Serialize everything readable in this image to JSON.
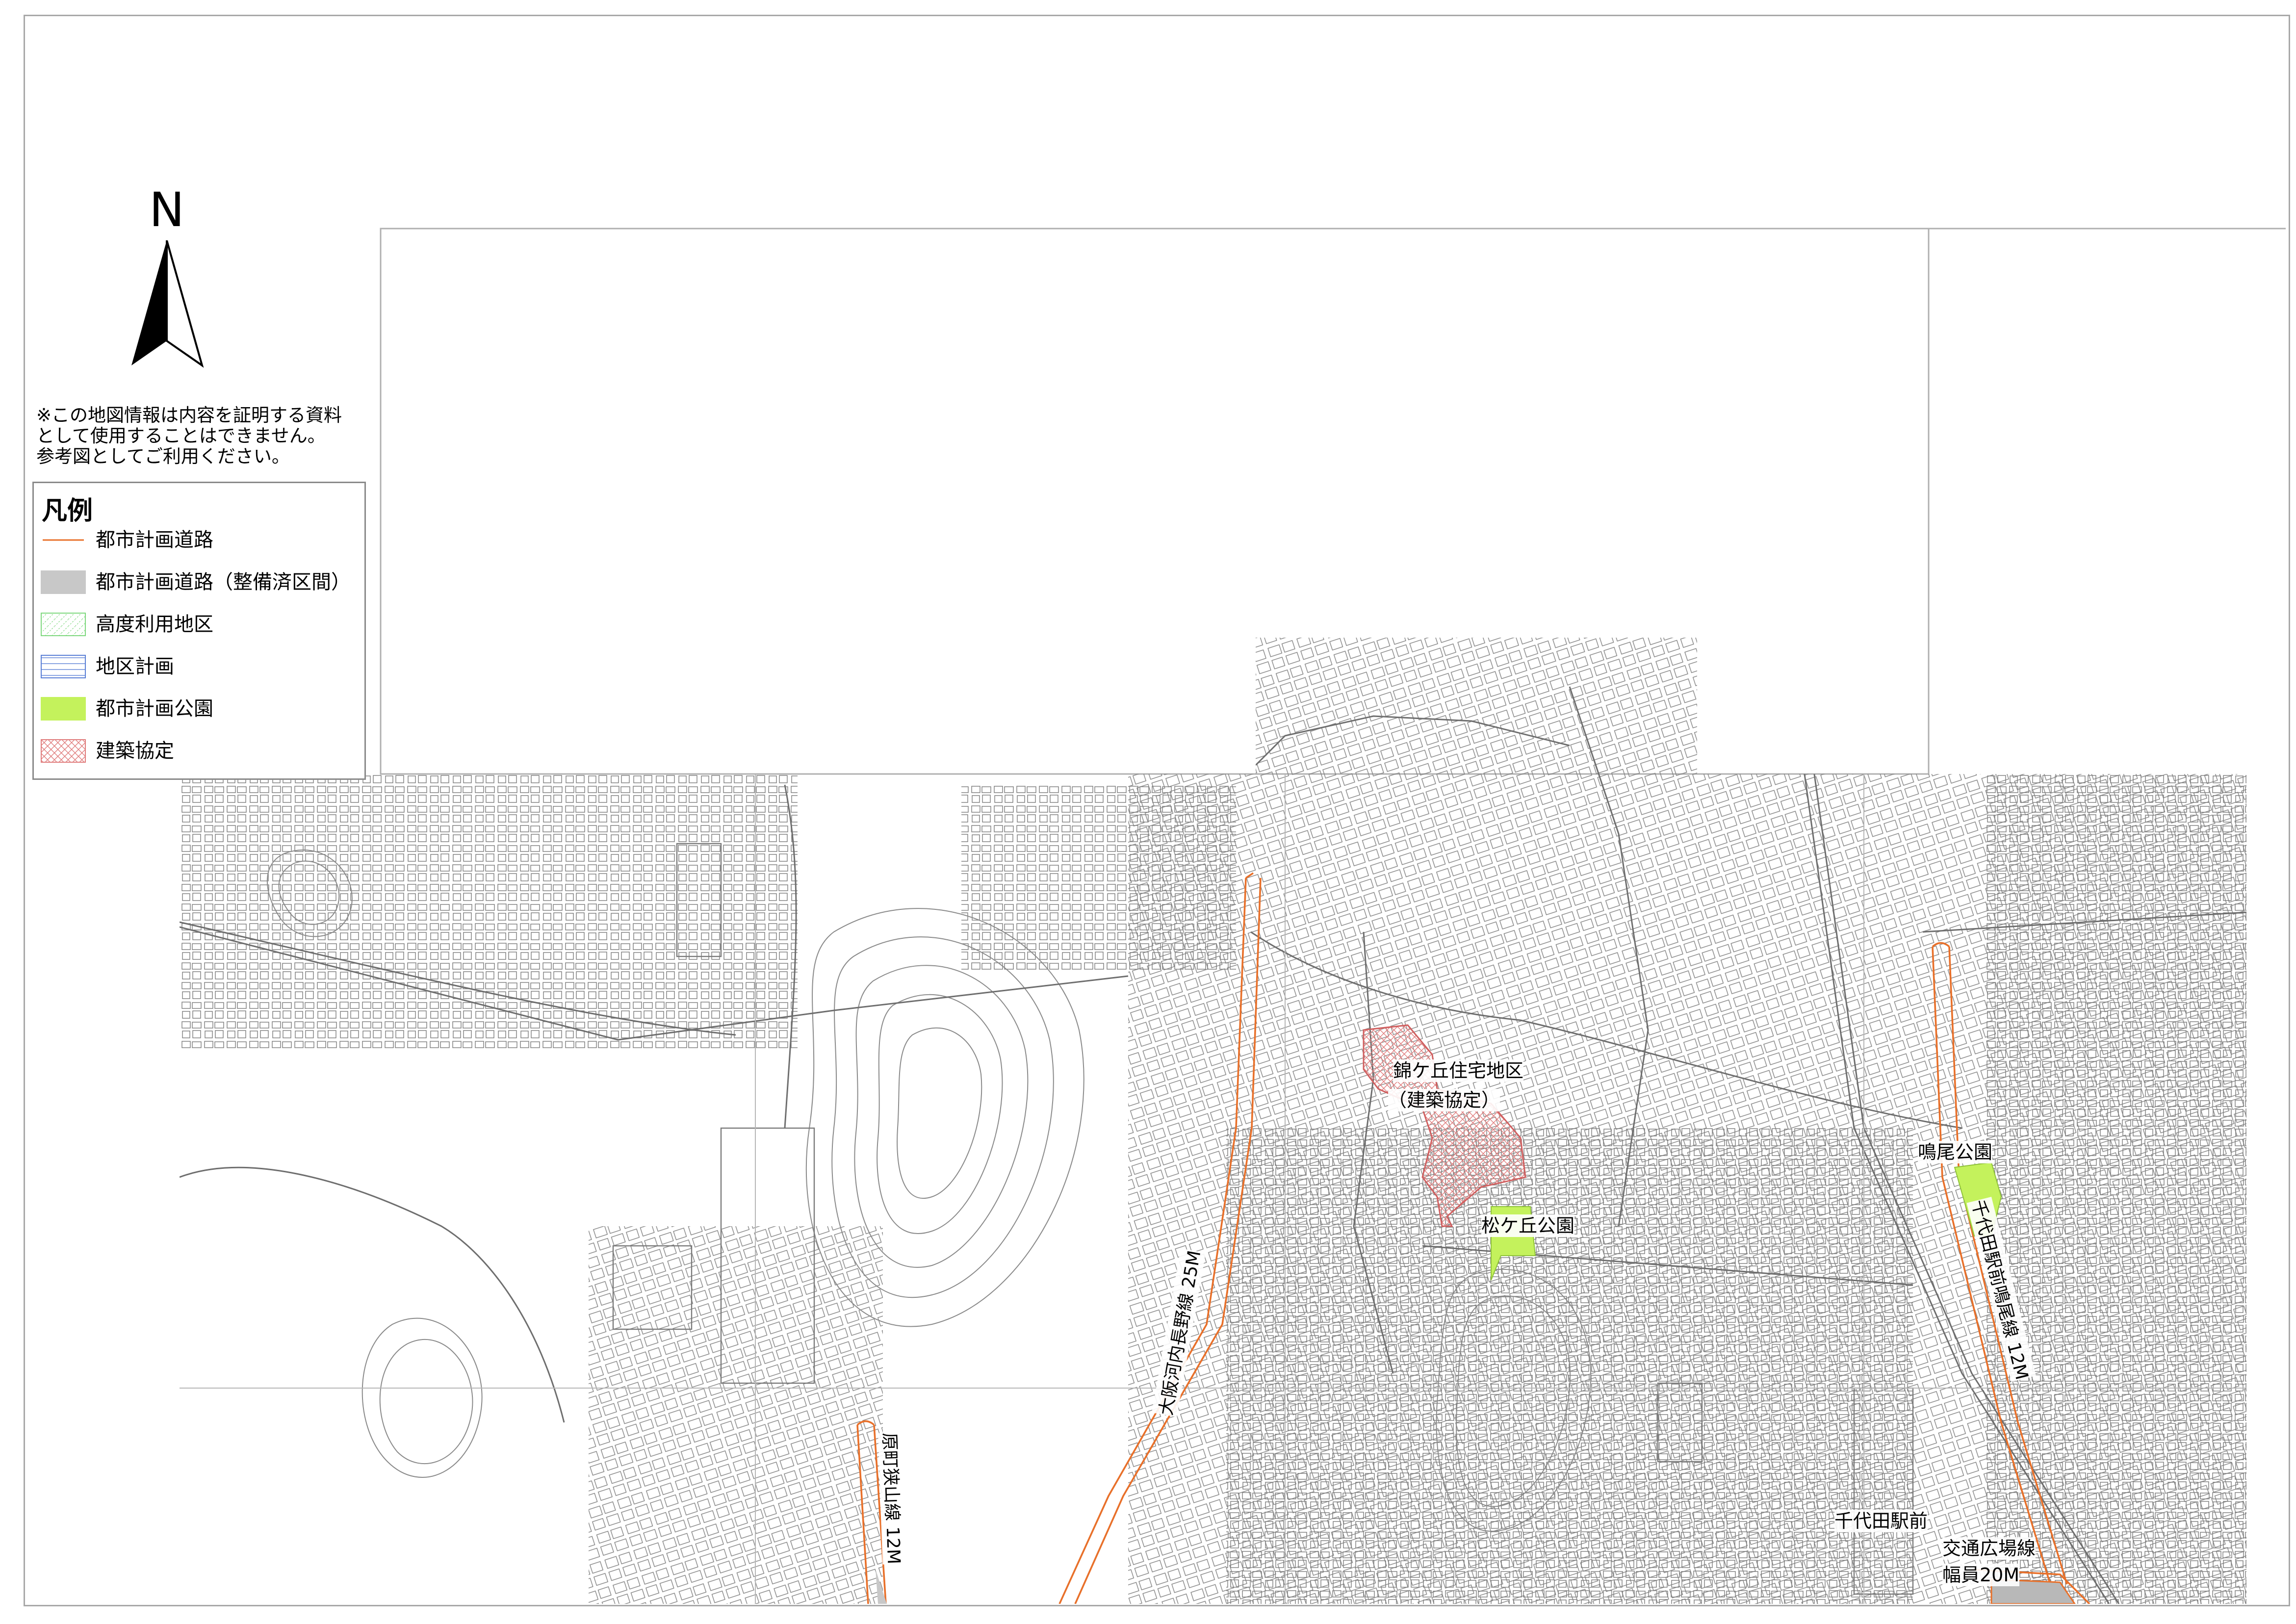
{
  "north_arrow": {
    "letter": "N"
  },
  "disclaimer": {
    "lines": [
      "※この地図情報は内容を証明する資料",
      "として使用することはできません。",
      "参考図としてご利用ください。"
    ]
  },
  "legend": {
    "title": "凡例",
    "items": [
      {
        "label": "都市計画道路",
        "style": "line",
        "color": "#e8702a"
      },
      {
        "label": "都市計画道路（整備済区間）",
        "style": "fill",
        "color": "#c8c8c8"
      },
      {
        "label": "高度利用地区",
        "style": "hatch-dots",
        "color": "#7ed87e"
      },
      {
        "label": "地区計画",
        "style": "hatch-lines",
        "color": "#5a7fd6"
      },
      {
        "label": "都市計画公園",
        "style": "fill",
        "color": "#c4f25c"
      },
      {
        "label": "建築協定",
        "style": "hatch-cross",
        "color": "#e07c7c"
      }
    ]
  },
  "map_labels": {
    "nishikigaoka_1": "錦ケ丘住宅地区",
    "nishikigaoka_2": "（建築協定）",
    "matsugaoka_park": "松ケ丘公園",
    "naruo_park": "鳴尾公園",
    "chiyoda_station_1": "千代田駅前",
    "chiyoda_station_2": "交通広場線",
    "chiyoda_station_3": "幅員20M",
    "road_osaka": "大阪河内長野線 25M",
    "road_haramachi": "原町狭山線 12M",
    "road_chiyoda": "千代田駅前鳴尾線 12M"
  },
  "colors": {
    "road": "#e8702a",
    "park": "#c4f25c",
    "agreement": "#e07c7c",
    "basemap": "#6e6e6e"
  }
}
